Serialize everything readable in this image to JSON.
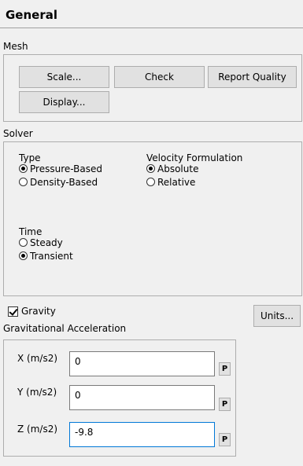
{
  "panel": {
    "title": "General"
  },
  "mesh": {
    "label": "Mesh",
    "buttons": {
      "scale": "Scale...",
      "check": "Check",
      "report_quality": "Report Quality",
      "display": "Display..."
    }
  },
  "solver": {
    "label": "Solver",
    "type": {
      "label": "Type",
      "options": [
        {
          "label": "Pressure-Based",
          "selected": true
        },
        {
          "label": "Density-Based",
          "selected": false
        }
      ]
    },
    "velocity_formulation": {
      "label": "Velocity Formulation",
      "options": [
        {
          "label": "Absolute",
          "selected": true
        },
        {
          "label": "Relative",
          "selected": false
        }
      ]
    },
    "time": {
      "label": "Time",
      "options": [
        {
          "label": "Steady",
          "selected": false
        },
        {
          "label": "Transient",
          "selected": true
        }
      ]
    }
  },
  "gravity": {
    "checkbox_label": "Gravity",
    "checked": true,
    "units_button": "Units...",
    "accel_label": "Gravitational Acceleration",
    "fields": [
      {
        "label": "X (m/s2)",
        "value": "0",
        "param_button": "P"
      },
      {
        "label": "Y (m/s2)",
        "value": "0",
        "param_button": "P"
      },
      {
        "label": "Z (m/s2)",
        "value": "-9.8",
        "param_button": "P"
      }
    ]
  },
  "colors": {
    "focus_border": "#0078d7",
    "panel_bg": "#f0f0f0",
    "group_border": "#adadad"
  }
}
